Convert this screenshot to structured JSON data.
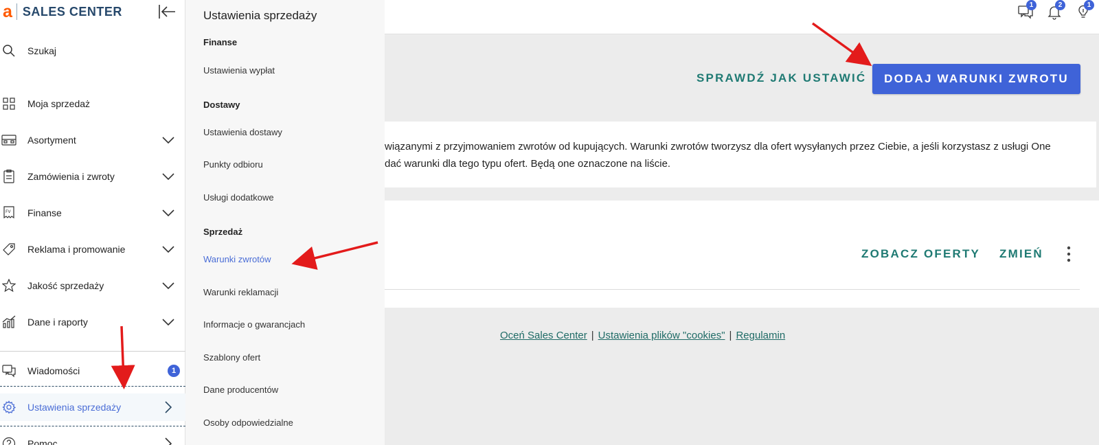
{
  "brand": {
    "logo_letter": "a",
    "name": "SALES CENTER"
  },
  "sidebar": {
    "search_label": "Szukaj",
    "items": [
      {
        "label": "Moja sprzedaż",
        "icon": "grid-icon"
      },
      {
        "label": "Asortyment",
        "icon": "inventory-icon"
      },
      {
        "label": "Zamówienia i zwroty",
        "icon": "orders-icon"
      },
      {
        "label": "Finanse",
        "icon": "finance-icon"
      },
      {
        "label": "Reklama i promowanie",
        "icon": "tag-icon"
      },
      {
        "label": "Jakość sprzedaży",
        "icon": "star-icon"
      },
      {
        "label": "Dane i raporty",
        "icon": "chart-icon"
      },
      {
        "label": "Wiadomości",
        "icon": "messages-icon",
        "badge": "1"
      },
      {
        "label": "Ustawienia sprzedaży",
        "icon": "gear-icon",
        "active": true
      },
      {
        "label": "Pomoc",
        "icon": "help-icon"
      }
    ]
  },
  "flyout": {
    "title": "Ustawienia sprzedaży",
    "sections": [
      {
        "name": "Finanse",
        "links": [
          "Ustawienia wypłat"
        ]
      },
      {
        "name": "Dostawy",
        "links": [
          "Ustawienia dostawy",
          "Punkty odbioru",
          "Usługi dodatkowe"
        ]
      },
      {
        "name": "Sprzedaż",
        "links": [
          "Warunki zwrotów",
          "Warunki reklamacji",
          "Informacje o gwarancjach",
          "Szablony ofert",
          "Dane producentów",
          "Osoby odpowiedzialne"
        ]
      }
    ],
    "active_link": "Warunki zwrotów"
  },
  "topbar": {
    "messages_badge": "1",
    "notifications_badge": "2",
    "tips_badge": "1"
  },
  "main": {
    "check_link": "SPRAWDŹ JAK USTAWIĆ",
    "add_button": "DODAJ WARUNKI ZWROTU",
    "info_line1": "wiązanymi z przyjmowaniem zwrotów od kupujących. Warunki zwrotów tworzysz dla ofert wysyłanych przez Ciebie, a jeśli korzystasz z usługi One",
    "info_line2": "dać warunki dla tego typu ofert. Będą one oznaczone na liście.",
    "see_offers": "ZOBACZ OFERTY",
    "change": "ZMIEŃ"
  },
  "footer": {
    "rate": "Oceń Sales Center",
    "cookies": "Ustawienia plików \"cookies\"",
    "terms": "Regulamin",
    "separator": "|"
  },
  "colors": {
    "accent": "#3f63d8",
    "teal_link": "#1f7a73",
    "brand_orange": "#ff5a00",
    "brand_navy": "#26486b",
    "annotation_red": "#e31b1b"
  }
}
